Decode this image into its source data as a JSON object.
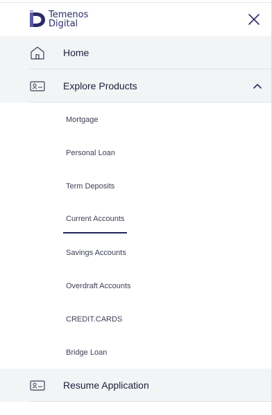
{
  "brand": {
    "line1": "Temenos",
    "line2": "Digital"
  },
  "menu": {
    "home_label": "Home",
    "explore_label": "Explore Products",
    "resume_label": "Resume Application"
  },
  "products": [
    "Mortgage",
    "Personal Loan",
    "Term Deposits",
    "Current Accounts",
    "Savings Accounts",
    "Overdraft Accounts",
    "CREDIT.CARDS",
    "Bridge Loan"
  ],
  "selected_product": "Current Accounts",
  "icons": {
    "close": "close-icon",
    "home": "home-icon",
    "explore": "id-card-icon",
    "resume": "id-card-icon",
    "expand": "chevron-up-icon"
  },
  "colors": {
    "accent": "#23265a",
    "brand": "#2b2c66",
    "row_shade": "#f2f4f6"
  }
}
